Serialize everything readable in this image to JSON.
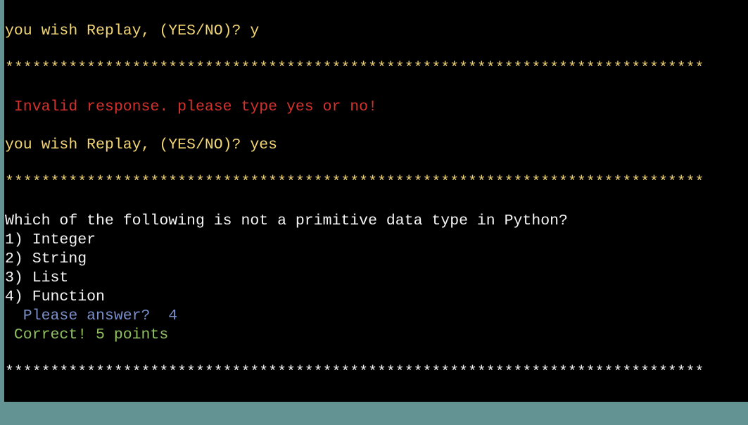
{
  "terminal": {
    "colors": {
      "background": "#000000",
      "frame": "#649393",
      "prompt": "#f2d675",
      "error": "#d4312d",
      "question": "#f5f5f5",
      "input_prompt": "#7a8fc9",
      "success": "#90c060"
    },
    "lines": [
      {
        "text": "you wish Replay, (YES/NO)? y"
      },
      {
        "text": "*****************************************************************************"
      },
      {
        "text": " Invalid response. please type yes or no!"
      },
      {
        "text": "you wish Replay, (YES/NO)? yes"
      },
      {
        "text": "*****************************************************************************"
      },
      {
        "text": "Which of the following is not a primitive data type in Python?"
      },
      {
        "text": "1) Integer"
      },
      {
        "text": "2) String"
      },
      {
        "text": "3) List"
      },
      {
        "text": "4) Function"
      },
      {
        "text": "  Please answer?  4"
      },
      {
        "text": " Correct! 5 points"
      },
      {
        "text": "*****************************************************************************"
      }
    ]
  }
}
